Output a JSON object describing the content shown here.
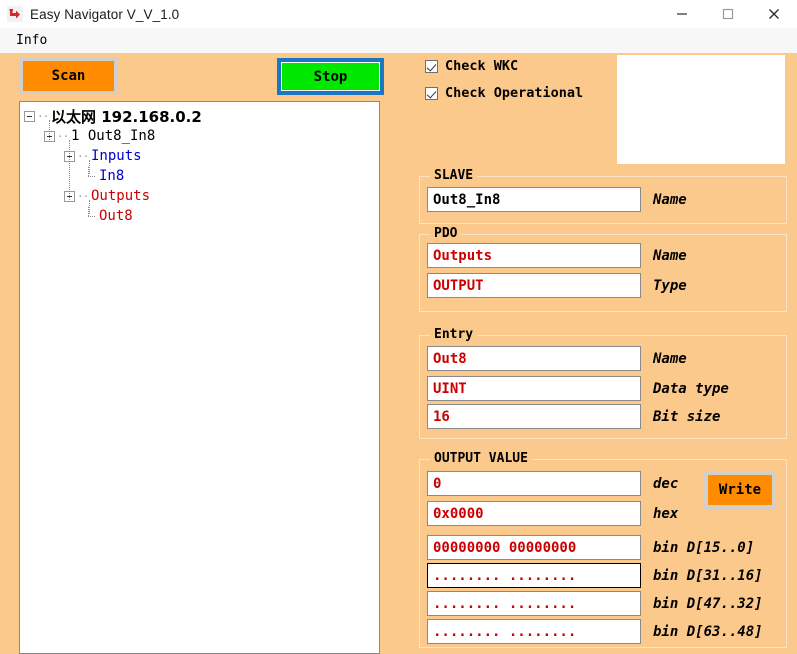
{
  "window": {
    "title": "Easy Navigator V_V_1.0",
    "icon": "app-refresh-icon",
    "minimize": "–",
    "maximize": "□",
    "close": "✕"
  },
  "menubar": {
    "items": [
      {
        "label": "Info"
      }
    ]
  },
  "toolbar": {
    "scan_label": "Scan",
    "stop_label": "Stop",
    "scan_color": "#ff8c00",
    "stop_color": "#00e800"
  },
  "tree": {
    "nodes": [
      {
        "level": 0,
        "label": "以太网 192.168.0.2",
        "color": "black",
        "expander": true,
        "cjk": true
      },
      {
        "level": 1,
        "label": "1 Out8_In8",
        "color": "black",
        "expander": true,
        "cjk": false
      },
      {
        "level": 2,
        "label": "Inputs",
        "color": "blue",
        "expander": true,
        "cjk": false
      },
      {
        "level": 3,
        "label": "In8",
        "color": "blue",
        "expander": false,
        "cjk": false
      },
      {
        "level": 2,
        "label": "Outputs",
        "color": "red",
        "expander": true,
        "cjk": false
      },
      {
        "level": 3,
        "label": "Out8",
        "color": "red",
        "expander": false,
        "cjk": false
      }
    ]
  },
  "options": {
    "check_wkc": {
      "label": "Check WKC",
      "checked": true
    },
    "check_operational": {
      "label": "Check Operational",
      "checked": true
    }
  },
  "log": {
    "text": ""
  },
  "slave": {
    "title": "SLAVE",
    "name_value": "Out8_In8",
    "name_caption": "Name"
  },
  "pdo": {
    "title": "PDO",
    "name_value": "Outputs",
    "name_caption": "Name",
    "type_value": "OUTPUT",
    "type_caption": "Type"
  },
  "entry": {
    "title": "Entry",
    "name_value": "Out8",
    "name_caption": "Name",
    "datatype_value": "UINT",
    "datatype_caption": "Data type",
    "bitsize_value": "16",
    "bitsize_caption": "Bit size"
  },
  "output_value": {
    "title": "OUTPUT VALUE",
    "dec_value": "0",
    "dec_caption": "dec",
    "hex_value": "0x0000",
    "hex_caption": "hex",
    "write_label": "Write",
    "bin_rows": [
      {
        "value": "00000000  00000000",
        "caption": "bin D[15..0]"
      },
      {
        "value": "........  ........",
        "caption": "bin D[31..16]"
      },
      {
        "value": "........  ........",
        "caption": "bin D[47..32]"
      },
      {
        "value": "........  ........",
        "caption": "bin D[63..48]"
      }
    ]
  }
}
